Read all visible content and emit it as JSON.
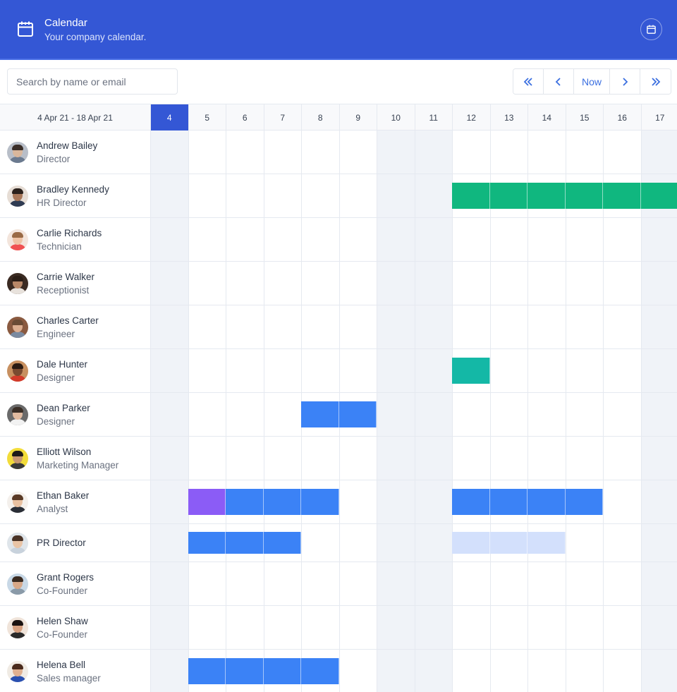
{
  "header": {
    "title": "Calendar",
    "subtitle": "Your company calendar.",
    "icon": "calendar-icon",
    "right_icon": "calendar-icon",
    "background": "#3457D5"
  },
  "toolbar": {
    "search_placeholder": "Search by name or email",
    "search_value": "",
    "nav": {
      "first": "«",
      "prev": "‹",
      "now": "Now",
      "next": "›",
      "last": "»"
    }
  },
  "calendar": {
    "range_label": "4 Apr 21 - 18 Apr 21",
    "today": 4,
    "days": [
      {
        "label": "4",
        "weekend": true
      },
      {
        "label": "5",
        "weekend": false
      },
      {
        "label": "6",
        "weekend": false
      },
      {
        "label": "7",
        "weekend": false
      },
      {
        "label": "8",
        "weekend": false
      },
      {
        "label": "9",
        "weekend": false
      },
      {
        "label": "10",
        "weekend": true
      },
      {
        "label": "11",
        "weekend": true
      },
      {
        "label": "12",
        "weekend": false
      },
      {
        "label": "13",
        "weekend": false
      },
      {
        "label": "14",
        "weekend": false
      },
      {
        "label": "15",
        "weekend": false
      },
      {
        "label": "16",
        "weekend": false
      },
      {
        "label": "17",
        "weekend": true
      }
    ],
    "colors": {
      "green": "#10B77F",
      "teal": "#14B8A6",
      "blue": "#3B82F6",
      "purple": "#8B5CF6",
      "light_blue": "#D3E0FC",
      "today": "#3457D5",
      "weekend": "#F0F3F8"
    },
    "people": [
      {
        "name": "Andrew Bailey",
        "role": "Director",
        "avatar": {
          "skin": "#d9b79c",
          "hair": "#3a2e28",
          "shirt": "#6b7a8f",
          "bg": "#b8bec8"
        },
        "events": []
      },
      {
        "name": "Bradley Kennedy",
        "role": "HR Director",
        "avatar": {
          "skin": "#a9785a",
          "hair": "#2b211c",
          "shirt": "#2f3b52",
          "bg": "#e6ddd5"
        },
        "events": [
          {
            "days": [
              "12",
              "13",
              "14",
              "15",
              "16",
              "17"
            ],
            "color": "green"
          }
        ]
      },
      {
        "name": "Carlie Richards",
        "role": "Technician",
        "avatar": {
          "skin": "#efc3a5",
          "hair": "#9a6a45",
          "shirt": "#f05252",
          "bg": "#f3e5dc"
        },
        "events": []
      },
      {
        "name": "Carrie Walker",
        "role": "Receptionist",
        "avatar": {
          "skin": "#b98868",
          "hair": "#2a1d16",
          "shirt": "#e8e2dc",
          "bg": "#3a2a22"
        },
        "events": []
      },
      {
        "name": "Charles Carter",
        "role": "Engineer",
        "avatar": {
          "skin": "#dcae90",
          "hair": "#6a4b35",
          "shirt": "#7a8aa0",
          "bg": "#8a5a40"
        },
        "events": []
      },
      {
        "name": "Dale Hunter",
        "role": "Designer",
        "avatar": {
          "skin": "#7a4a30",
          "hair": "#2a1a12",
          "shirt": "#d23a2a",
          "bg": "#c89060"
        },
        "events": [
          {
            "days": [
              "12"
            ],
            "color": "teal"
          }
        ]
      },
      {
        "name": "Dean Parker",
        "role": "Designer",
        "avatar": {
          "skin": "#e2bba0",
          "hair": "#3a2e26",
          "shirt": "#f2f2f2",
          "bg": "#6a6a6a"
        },
        "events": [
          {
            "days": [
              "8",
              "9"
            ],
            "color": "blue"
          }
        ]
      },
      {
        "name": "Elliott Wilson",
        "role": "Marketing Manager",
        "avatar": {
          "skin": "#c99870",
          "hair": "#1e1a18",
          "shirt": "#3a3a3a",
          "bg": "#f2dc3a"
        },
        "events": []
      },
      {
        "name": "Ethan Baker",
        "role": "Analyst",
        "avatar": {
          "skin": "#e8c0a0",
          "hair": "#5a3a26",
          "shirt": "#2a2e36",
          "bg": "#f4f0ec"
        },
        "events": [
          {
            "days": [
              "5"
            ],
            "color": "purple"
          },
          {
            "days": [
              "6",
              "7",
              "8"
            ],
            "color": "blue"
          },
          {
            "days": [
              "12",
              "13",
              "14",
              "15"
            ],
            "color": "blue"
          }
        ]
      },
      {
        "name": "",
        "role": "PR Director",
        "avatar": {
          "skin": "#e9c4a6",
          "hair": "#4a3326",
          "shirt": "#c8d2dc",
          "bg": "#dfe5ea"
        },
        "events": [
          {
            "days": [
              "5",
              "6",
              "7"
            ],
            "color": "blue"
          },
          {
            "days": [
              "12",
              "13",
              "14"
            ],
            "color": "light_blue"
          }
        ]
      },
      {
        "name": "Grant Rogers",
        "role": "Co-Founder",
        "avatar": {
          "skin": "#d8a888",
          "hair": "#3a2a20",
          "shirt": "#8a9aa8",
          "bg": "#c8d8e6"
        },
        "events": []
      },
      {
        "name": "Helen Shaw",
        "role": "Co-Founder",
        "avatar": {
          "skin": "#d6a080",
          "hair": "#1a1210",
          "shirt": "#2a2a2a",
          "bg": "#f0e4da"
        },
        "events": []
      },
      {
        "name": "Helena Bell",
        "role": "Sales manager",
        "avatar": {
          "skin": "#e0b090",
          "hair": "#4a2a1c",
          "shirt": "#2a50b0",
          "bg": "#f0ebe4"
        },
        "events": [
          {
            "days": [
              "5",
              "6",
              "7",
              "8"
            ],
            "color": "blue"
          }
        ]
      }
    ]
  }
}
